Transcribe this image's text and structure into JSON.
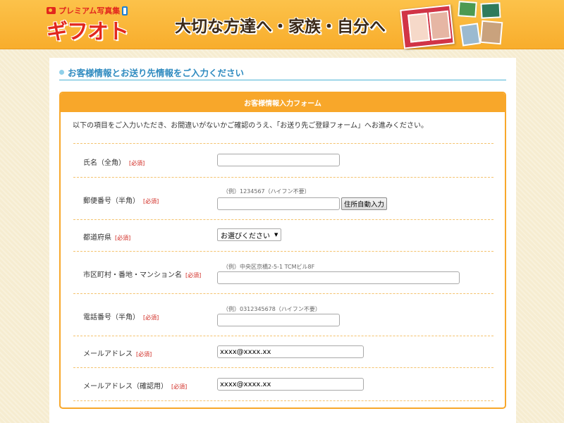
{
  "header": {
    "logo_sub": "プレミアム写真集",
    "logo_main": "ギフ",
    "logo_main2": "ト",
    "logo_mid": "オ",
    "tagline": "大切な方達へ・家族・自分へ"
  },
  "section": {
    "title": "お客様情報とお送り先情報をご入力ください"
  },
  "form": {
    "title": "お客様情報入力フォーム",
    "intro": "以下の項目をご入力いただき、お間違いがないかご確認のうえ、「お送り先ご登録フォーム」へお進みください。",
    "required_label": "[必須]",
    "fields": {
      "name": {
        "label": "氏名（全角）",
        "value": ""
      },
      "zip": {
        "label": "郵便番号（半角）",
        "hint": "（例）1234567（ハイフン不要）",
        "value": "",
        "button": "住所自動入力"
      },
      "pref": {
        "label": "都道府県",
        "selected": "お選びください"
      },
      "address": {
        "label": "市区町村・番地・マンション名",
        "hint": "（例）中央区京橋2-5-1 TCMビル8F",
        "value": ""
      },
      "phone": {
        "label": "電話番号（半角）",
        "hint": "（例）0312345678（ハイフン不要）",
        "value": ""
      },
      "email": {
        "label": "メールアドレス",
        "value": "xxxx@xxxx.xx"
      },
      "email_confirm": {
        "label": "メールアドレス（確認用）",
        "value": "xxxx@xxxx.xx"
      }
    }
  },
  "colors": {
    "accent": "#f8a72a",
    "header": "#fbb93b",
    "title": "#2f8bc0",
    "required": "#d0261e"
  }
}
